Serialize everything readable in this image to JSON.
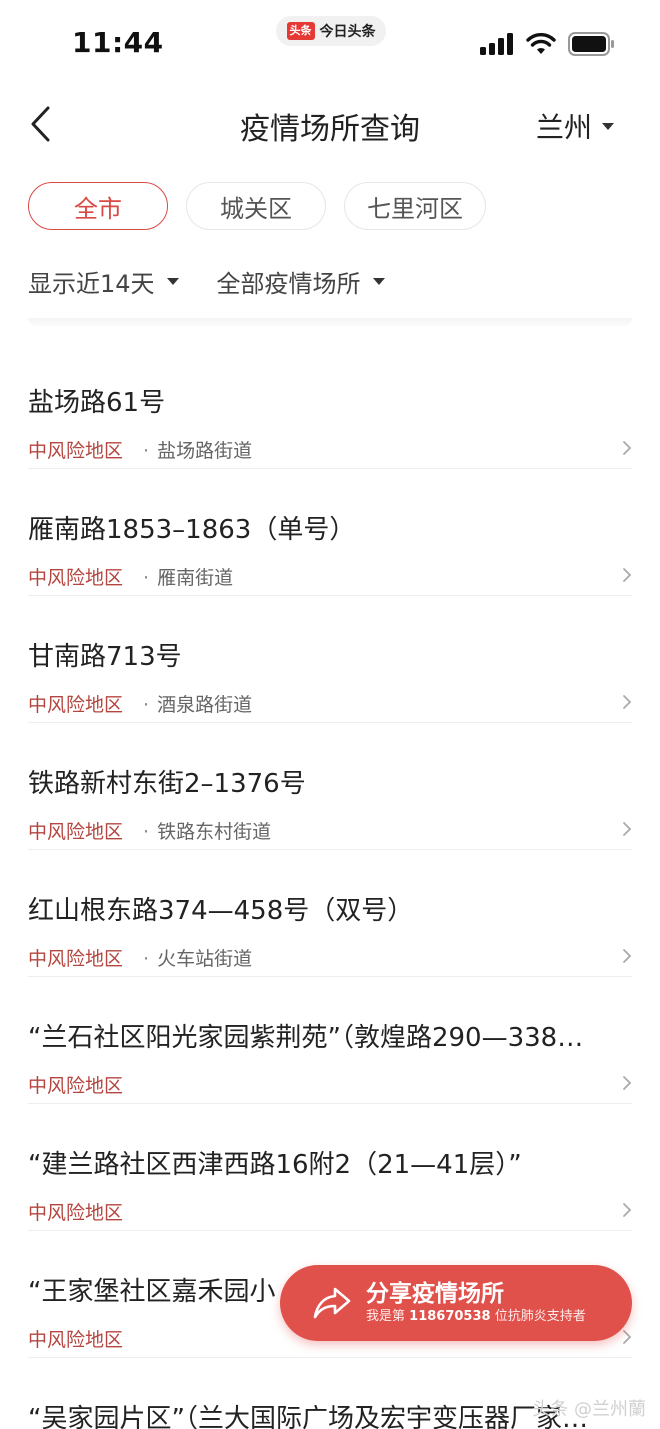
{
  "status_bar": {
    "time": "11:44",
    "app_badge": "头条",
    "app_name": "今日头条",
    "icons": [
      "signal-icon",
      "wifi-icon",
      "battery-icon"
    ]
  },
  "header": {
    "title": "疫情场所查询",
    "city": "兰州"
  },
  "districts": [
    {
      "label": "全市",
      "active": true
    },
    {
      "label": "城关区",
      "active": false
    },
    {
      "label": "七里河区",
      "active": false
    }
  ],
  "filters": {
    "days": "显示近14天",
    "place_type": "全部疫情场所"
  },
  "items": [
    {
      "title": "盐场路61号",
      "risk": "中风险地区",
      "street": "盐场路街道"
    },
    {
      "title": "雁南路1853–1863（单号）",
      "risk": "中风险地区",
      "street": "雁南街道"
    },
    {
      "title": "甘南路713号",
      "risk": "中风险地区",
      "street": "酒泉路街道"
    },
    {
      "title": "铁路新村东街2–1376号",
      "risk": "中风险地区",
      "street": "铁路东村街道"
    },
    {
      "title": "红山根东路374—458号（双号）",
      "risk": "中风险地区",
      "street": "火车站街道"
    },
    {
      "title": "“兰石社区阳光家园紫荆苑”（敦煌路290—338…",
      "risk": "中风险地区",
      "street": ""
    },
    {
      "title": "“建兰路社区西津西路16附2（21—41层）”",
      "risk": "中风险地区",
      "street": ""
    },
    {
      "title": "“王家堡社区嘉禾园小",
      "risk": "中风险地区",
      "street": ""
    },
    {
      "title": "“吴家园片区”（兰大国际广场及宏宇变压器厂家…",
      "risk": "",
      "street": ""
    }
  ],
  "share": {
    "title": "分享疫情场所",
    "sub_prefix": "我是第",
    "sub_number": "118670538",
    "sub_suffix": "位抗肺炎支持者"
  },
  "watermark": "头条 @兰州蘭",
  "colors": {
    "accent": "#d84a44",
    "risk_text": "#b5453f",
    "fab": "#e0514b"
  }
}
